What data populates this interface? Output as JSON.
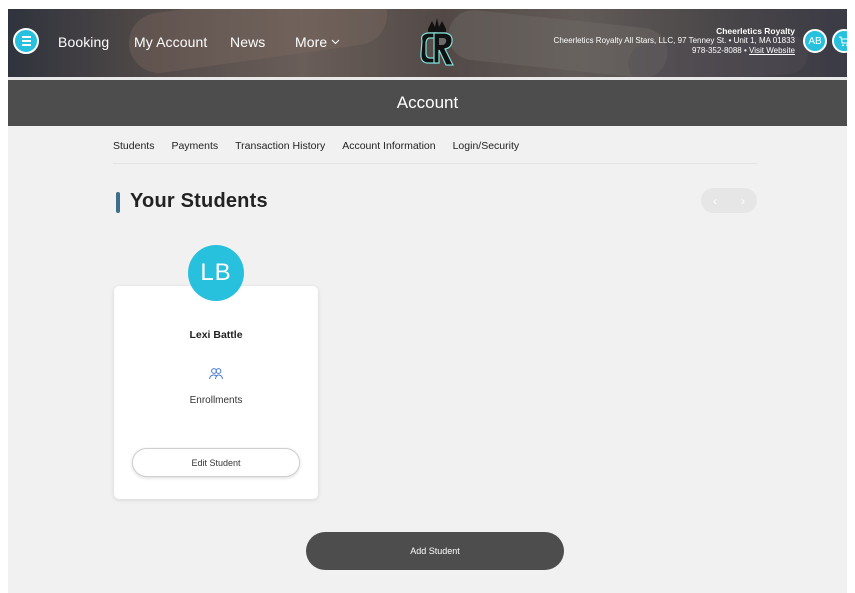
{
  "header": {
    "nav_items": [
      "Booking",
      "My Account",
      "News",
      "More"
    ],
    "org_name": "Cheerletics Royalty",
    "org_address": "Cheerletics Royalty All Stars, LLC, 97 Tenney St. • Unit 1, MA 01833",
    "org_phone": "978-352-8088",
    "org_separator": "•",
    "visit_link": "Visit Website",
    "user_initials": "AB",
    "icons": {
      "menu": "hamburger-icon",
      "more": "chevron-down-icon",
      "cart": "cart-icon"
    },
    "accent_color": "#27c0dd"
  },
  "page": {
    "title": "Account"
  },
  "subnav": {
    "tabs": [
      "Students",
      "Payments",
      "Transaction History",
      "Account Information",
      "Login/Security"
    ]
  },
  "students_section": {
    "title": "Your Students",
    "pager": {
      "prev": "‹",
      "next": "›"
    },
    "students": [
      {
        "initials": "LB",
        "name": "Lexi Battle",
        "enrollments_label": "Enrollments",
        "edit_label": "Edit Student"
      }
    ],
    "add_label": "Add Student"
  }
}
